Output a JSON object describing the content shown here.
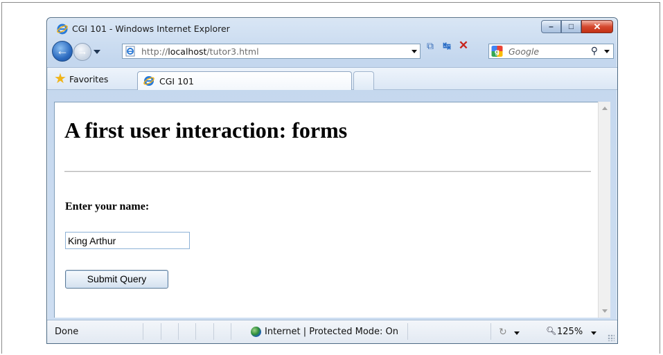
{
  "window": {
    "title": "CGI 101 - Windows Internet Explorer",
    "min_glyph": "–",
    "max_glyph": "□",
    "close_glyph": "✕"
  },
  "nav": {
    "back_icon": "back-arrow-icon",
    "forward_icon": "forward-arrow-icon",
    "address_prefix": "http://",
    "address_host": "localhost",
    "address_path": "/tutor3.html",
    "refresh_icon": "refresh-icon",
    "stop_icon": "stop-icon"
  },
  "search": {
    "placeholder": "Google",
    "go_icon": "magnifier-icon"
  },
  "tabs": {
    "favorites_label": "Favorites",
    "active_tab_label": "CGI 101"
  },
  "page": {
    "heading": "A first user interaction: forms",
    "form_label": "Enter your name:",
    "input_value": "King Arthur",
    "submit_label": "Submit Query"
  },
  "status": {
    "text": "Done",
    "zone_text": "Internet | Protected Mode: On",
    "zoom_text": "125%"
  },
  "colors": {
    "chrome_accent": "#c4d7ee",
    "close_button": "#c23014"
  }
}
